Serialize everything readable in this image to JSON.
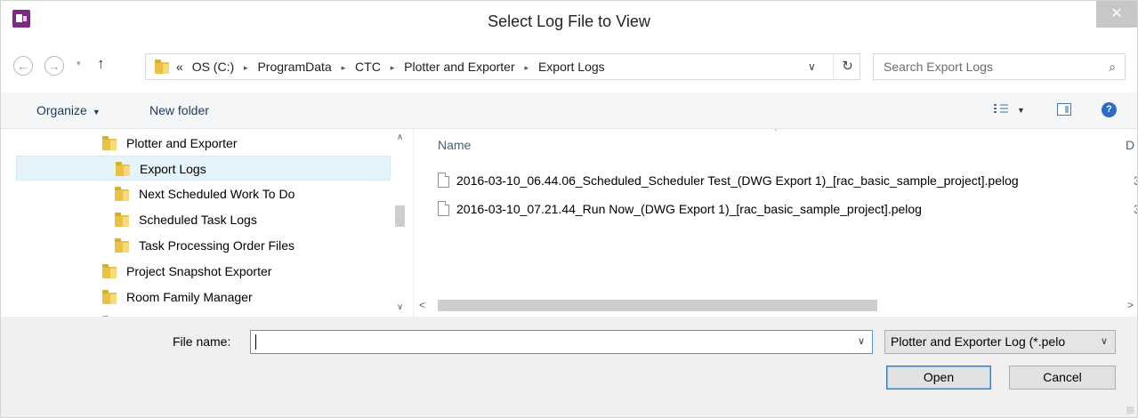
{
  "window": {
    "title": "Select Log File to View",
    "close_symbol": "✕",
    "app_icon": "powerpoint-style-app-icon"
  },
  "address_bar": {
    "back_symbol": "←",
    "forward_symbol": "→",
    "recent_symbol": "▾",
    "up_symbol": "↑",
    "overflow_symbol": "«",
    "separator": "▸",
    "crumbs": [
      "OS (C:)",
      "ProgramData",
      "CTC",
      "Plotter and Exporter",
      "Export Logs"
    ],
    "dropdown_symbol": "∨",
    "refresh_symbol": "↻"
  },
  "search": {
    "placeholder": "Search Export Logs",
    "icon_symbol": "⌕"
  },
  "toolbar": {
    "organize_label": "Organize",
    "organize_caret": "▼",
    "new_folder_label": "New folder",
    "views_caret": "▼",
    "help_symbol": "?"
  },
  "nav_pane": {
    "items": [
      {
        "label": "Plotter and Exporter",
        "level": 1,
        "selected": false
      },
      {
        "label": "Export Logs",
        "level": 2,
        "selected": true
      },
      {
        "label": "Next Scheduled Work To Do",
        "level": 2,
        "selected": false
      },
      {
        "label": "Scheduled Task Logs",
        "level": 2,
        "selected": false
      },
      {
        "label": "Task Processing Order Files",
        "level": 2,
        "selected": false
      },
      {
        "label": "Project Snapshot Exporter",
        "level": 1,
        "selected": false
      },
      {
        "label": "Room Family Manager",
        "level": 1,
        "selected": false
      }
    ],
    "scroll_up": "∧",
    "scroll_down": "∨"
  },
  "file_list": {
    "column_name": "Name",
    "column_next": "D",
    "sort_indicator": "ˆ",
    "files": [
      {
        "name": "2016-03-10_06.44.06_Scheduled_Scheduler Test_(DWG Export 1)_[rac_basic_sample_project].pelog",
        "next": "3"
      },
      {
        "name": "2016-03-10_07.21.44_Run Now_(DWG Export 1)_[rac_basic_sample_project].pelog",
        "next": "3"
      }
    ],
    "scroll_left": "<",
    "scroll_right": ">"
  },
  "bottom": {
    "file_name_label": "File name:",
    "file_name_value": "",
    "file_name_drop": "∨",
    "filter_value": "Plotter and Exporter Log (*.pelo",
    "filter_drop": "∨",
    "open_label": "Open",
    "cancel_label": "Cancel"
  },
  "colors": {
    "accent_blue": "#5694d6",
    "selection_bg": "#e5f3fb",
    "folder_yellow": "#e9c243",
    "toolbar_text": "#1e395b"
  }
}
